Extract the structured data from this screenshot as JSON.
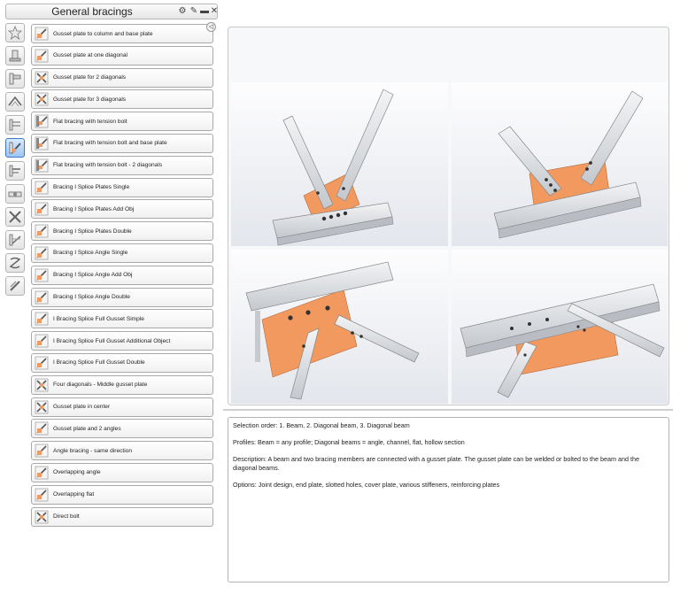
{
  "window": {
    "title": "General bracings",
    "buttons": [
      "gear-icon",
      "pin-icon",
      "minimize-icon",
      "close-icon"
    ]
  },
  "toolbar": [
    {
      "name": "favorites",
      "icon": "star-icon",
      "active": false
    },
    {
      "name": "base-plates",
      "icon": "base-plate-icon",
      "active": false
    },
    {
      "name": "frame-joints",
      "icon": "frame-joint-icon",
      "active": false
    },
    {
      "name": "roof-bracing",
      "icon": "roof-bracing-icon",
      "active": false
    },
    {
      "name": "stair-joints",
      "icon": "stair-icon",
      "active": false
    },
    {
      "name": "general-bracings",
      "icon": "diagonal-bracing-icon",
      "active": true
    },
    {
      "name": "beam-to-column",
      "icon": "beam-column-icon",
      "active": false
    },
    {
      "name": "bolted-joints",
      "icon": "bolt-joint-icon",
      "active": false
    },
    {
      "name": "cross-bracings",
      "icon": "cross-bracing-icon",
      "active": false
    },
    {
      "name": "truss-joints",
      "icon": "truss-icon",
      "active": false
    },
    {
      "name": "splices",
      "icon": "splice-icon",
      "active": false
    },
    {
      "name": "miscellaneous",
      "icon": "misc-icon",
      "active": false
    }
  ],
  "items": [
    "Gusset plate to column and base plate",
    "Gusset plate at one diagonal",
    "Gusset plate for 2 diagonals",
    "Gusset plate for 3 diagonals",
    "Flat bracing with tension bolt",
    "Flat bracing with tension bolt and base plate",
    "Flat bracing with tension bolt - 2 diagonals",
    "Bracing I Splice Plates Single",
    "Bracing I Splice Plates Add Obj",
    "Bracing I Splice Plates Double",
    "Bracing I Splice Angle Single",
    "Bracing I Splice Angle Add Obj",
    "Bracing I Splice Angle Double",
    "I Bracing Splice Full Gusset Simple",
    "I Bracing Splice Full Gusset Additional Object",
    "I Bracing Splice Full Gusset Double",
    "Four diagonals - Middle gusset plate",
    "Gusset plate in center",
    "Gusset plate and 2 angles",
    "Angle bracing - same direction",
    "Overlapping angle",
    "Overlapping flat",
    "Direct bolt"
  ],
  "description": {
    "selection_order": "Selection order: 1. Beam, 2. Diagonal beam, 3. Diagonal beam",
    "profiles": "Profiles: Beam = any profile; Diagonal beams = angle, channel, flat, hollow section",
    "description": "Description: A beam and two bracing members are connected with a gusset plate.  The gusset plate can be welded or bolted to the beam and the diagonal beams.",
    "options": "Options: Joint design, end plate, slotted holes, cover plate, various stiffeners, reinforcing plates"
  },
  "colors": {
    "gusset": "#f2995f",
    "steel": "#d9dce0",
    "active_tab": "#9cc6f2"
  }
}
